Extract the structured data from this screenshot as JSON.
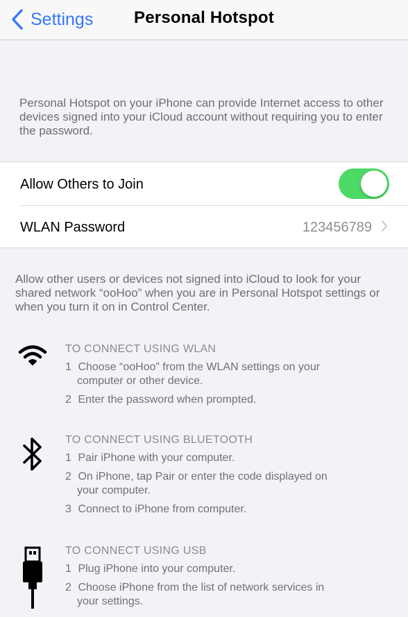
{
  "nav": {
    "back_label": "Settings",
    "title": "Personal Hotspot"
  },
  "intro_text": "Personal Hotspot on your iPhone can provide Internet access to other devices signed into your iCloud account without requiring you to enter the password.",
  "settings": {
    "allow_others": {
      "label": "Allow Others to Join",
      "enabled": true
    },
    "wlan_password": {
      "label": "WLAN Password",
      "value": "123456789"
    }
  },
  "note_text": "Allow other users or devices not signed into iCloud to look for your shared network “ooHoo” when you are in Personal Hotspot settings or when you turn it on in Control Center.",
  "sections": {
    "wlan": {
      "heading": "TO CONNECT USING WLAN",
      "steps": [
        {
          "num": "1",
          "line1": "Choose “ooHoo” from the WLAN settings on your",
          "line2": "computer or other device."
        },
        {
          "num": "2",
          "line1": "Enter the password when prompted.",
          "line2": ""
        }
      ]
    },
    "bluetooth": {
      "heading": "TO CONNECT USING BLUETOOTH",
      "steps": [
        {
          "num": "1",
          "line1": "Pair iPhone with your computer.",
          "line2": ""
        },
        {
          "num": "2",
          "line1": "On iPhone, tap Pair or enter the code displayed on",
          "line2": "your computer."
        },
        {
          "num": "3",
          "line1": "Connect to iPhone from computer.",
          "line2": ""
        }
      ]
    },
    "usb": {
      "heading": "TO CONNECT USING USB",
      "steps": [
        {
          "num": "1",
          "line1": "Plug iPhone into your computer.",
          "line2": ""
        },
        {
          "num": "2",
          "line1": "Choose iPhone from the list of network services in",
          "line2": "your settings."
        }
      ]
    }
  },
  "icons": {
    "back": "chevron-left-icon",
    "disclosure": "chevron-right-icon",
    "wlan": "wifi-icon",
    "bluetooth": "bluetooth-icon",
    "usb": "usb-icon"
  },
  "colors": {
    "accent": "#3478f6",
    "toggle_on": "#4cd964",
    "background": "#f2f2f7"
  }
}
